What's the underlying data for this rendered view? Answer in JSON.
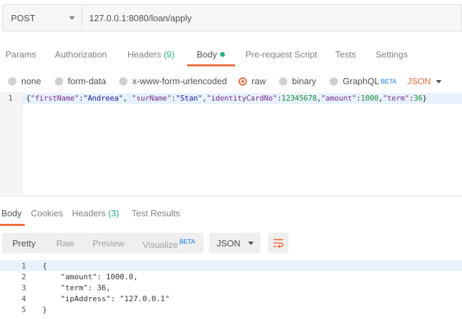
{
  "request": {
    "method": "POST",
    "url": "127.0.0.1:8080/loan/apply"
  },
  "req_tabs": {
    "params": "Params",
    "authorization": "Authorization",
    "headers": "Headers",
    "headers_count": "(9)",
    "body": "Body",
    "prerequest": "Pre-request Script",
    "tests": "Tests",
    "settings": "Settings"
  },
  "body_types": {
    "none": "none",
    "form_data": "form-data",
    "urlencoded": "x-www-form-urlencoded",
    "raw": "raw",
    "binary": "binary",
    "graphql": "GraphQL",
    "graphql_badge": "BETA",
    "selected": "raw",
    "language": "JSON"
  },
  "editor": {
    "line_number": "1",
    "punct_open": "{",
    "key1": "\"firstName\"",
    "val1": "\"Andreea\"",
    "key2": "\"surName\"",
    "val2": "\"Stan\"",
    "key3": "\"identityCardNo\"",
    "val3": "12345678",
    "key4": "\"amount\"",
    "val4": "1000",
    "key5": "\"term\"",
    "val5": "36",
    "punct_close": "}"
  },
  "resp_tabs": {
    "body": "Body",
    "cookies": "Cookies",
    "headers": "Headers",
    "headers_count": "(3)",
    "test_results": "Test Results"
  },
  "resp_toolbar": {
    "pretty": "Pretty",
    "raw": "Raw",
    "preview": "Preview",
    "visualize": "Visualize",
    "visualize_badge": "BETA",
    "format": "JSON"
  },
  "response": {
    "lines": [
      {
        "num": "1",
        "text": "{"
      },
      {
        "num": "2",
        "text": "    \"amount\": 1000.0,"
      },
      {
        "num": "3",
        "text": "    \"term\": 36,"
      },
      {
        "num": "4",
        "text": "    \"ipAddress\": \"127.0.0.1\""
      },
      {
        "num": "5",
        "text": "}"
      }
    ]
  },
  "colors": {
    "accent": "#f26b3a",
    "success": "#26b47f",
    "badge": "#097bed"
  }
}
